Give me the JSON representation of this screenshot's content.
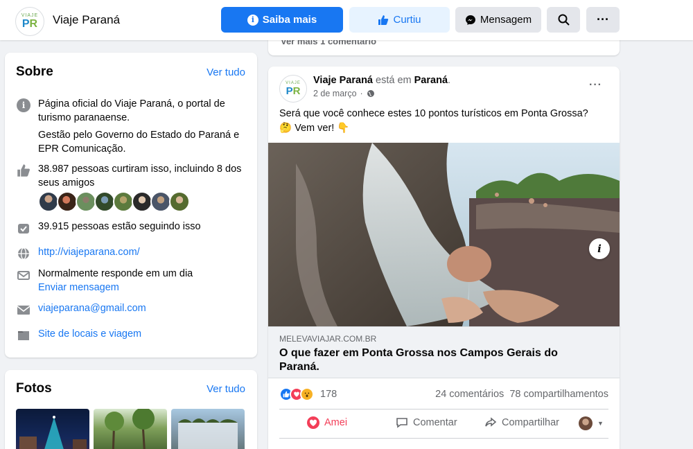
{
  "header": {
    "page_name": "Viaje Paraná",
    "logo_top": "VIAJE",
    "logo_p": "P",
    "logo_r": "R",
    "buttons": {
      "saiba_mais": "Saiba mais",
      "curtiu": "Curtiu",
      "mensagem": "Mensagem"
    },
    "icons": [
      "info-icon",
      "thumbs-up-icon",
      "messenger-icon",
      "search-icon",
      "more-icon"
    ]
  },
  "about": {
    "title": "Sobre",
    "see_all": "Ver tudo",
    "description": "Página oficial do Viaje Paraná, o portal de turismo paranaense.",
    "management": "Gestão pelo Governo do Estado do Paraná e EPR Comunicação.",
    "likes": "38.987 pessoas curtiram isso, incluindo 8 dos seus amigos",
    "followers": "39.915 pessoas estão seguindo isso",
    "website": "http://viajeparana.com/",
    "response": "Normalmente responde em um dia",
    "send_message": "Enviar mensagem",
    "email": "viajeparana@gmail.com",
    "category": "Site de locais e viagem"
  },
  "photos": {
    "title": "Fotos",
    "see_all": "Ver tudo"
  },
  "prev_post": {
    "more_comments": "Ver mais 1 comentário"
  },
  "post": {
    "author": "Viaje Paraná",
    "mid_text": " está em ",
    "place": "Paraná",
    "after_place": ".",
    "date": "2 de março",
    "dot": "·",
    "text_line1": "Será que você conhece estes 10 pontos turísticos em Ponta Grossa?",
    "text_line2": "🤔 Vem ver! 👇",
    "link_domain": "MELEVAVIAJAR.COM.BR",
    "link_title": "O que fazer em Ponta Grossa nos Campos Gerais do Paraná.",
    "reaction_count": "178",
    "comments": "24 comentários",
    "shares": "78 compartilhamentos",
    "actions": {
      "love": "Amei",
      "comment": "Comentar",
      "share": "Compartilhar"
    },
    "colors": {
      "love": "#f33e58",
      "like": "#1877f2",
      "wow": "#f7b125"
    }
  }
}
